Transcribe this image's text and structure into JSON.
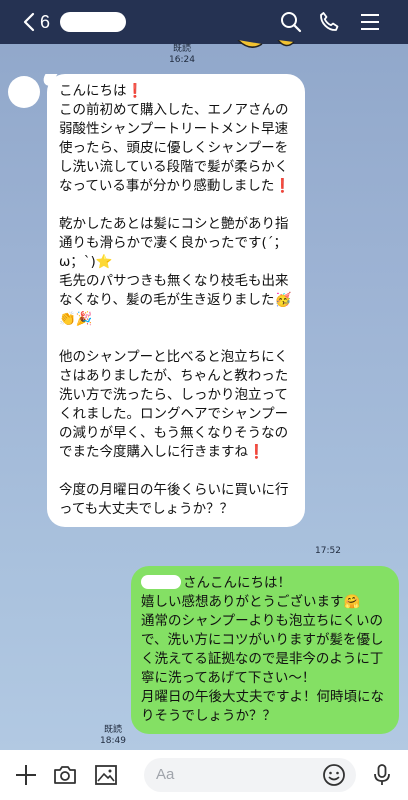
{
  "header": {
    "unread_count": "6",
    "icons": [
      "chevron-left-icon",
      "search-icon",
      "phone-icon",
      "menu-icon"
    ],
    "bg_color": "#253252"
  },
  "messages": [
    {
      "side": "received",
      "text": "こんにちは❗️\nこの前初めて購入した、エノアさんの弱酸性シャンプートリートメント早速使ったら、頭皮に優しくシャンプーをし洗い流している段階で髪が柔らかくなっている事が分かり感動しました❗️\n\n乾かしたあとは髪にコシと艶があり指通りも滑らかで凄く良かったです(´；ω；`)⭐️\n毛先のパサつきも無くなり枝毛も出来なくなり、髪の毛が生き返りました🥳👏🎉\n\n他のシャンプーと比べると泡立ちにくさはありましたが、ちゃんと教わった洗い方で洗ったら、しっかり泡立ってくれました。ロングヘアでシャンプーの減りが早く、もう無くなりそうなのでまた今度購入しに行きますね❗️\n\n今度の月曜日の午後くらいに買いに行っても大丈夫でしょうか？？",
      "time": "17:52"
    },
    {
      "side": "sent",
      "text_after_name": "さんこんにちは！\n嬉しい感想ありがとうございます🤗\n通常のシャンプーよりも泡立ちにくいので、洗い方にコツがいりますが髪を優しく洗えてる証拠なので是非今のように丁寧に洗ってあげて下さい〜！\n月曜日の午後大丈夫ですよ！何時頃になりそうでしょうか？？",
      "read_label": "既読",
      "time": "18:49",
      "bubble_color": "#84e064"
    }
  ],
  "top_meta": {
    "read_label": "既読",
    "time": "16:24"
  },
  "footer": {
    "input_placeholder": "Aa",
    "icons": [
      "plus-icon",
      "camera-icon",
      "image-icon",
      "emoji-icon",
      "microphone-icon"
    ]
  }
}
